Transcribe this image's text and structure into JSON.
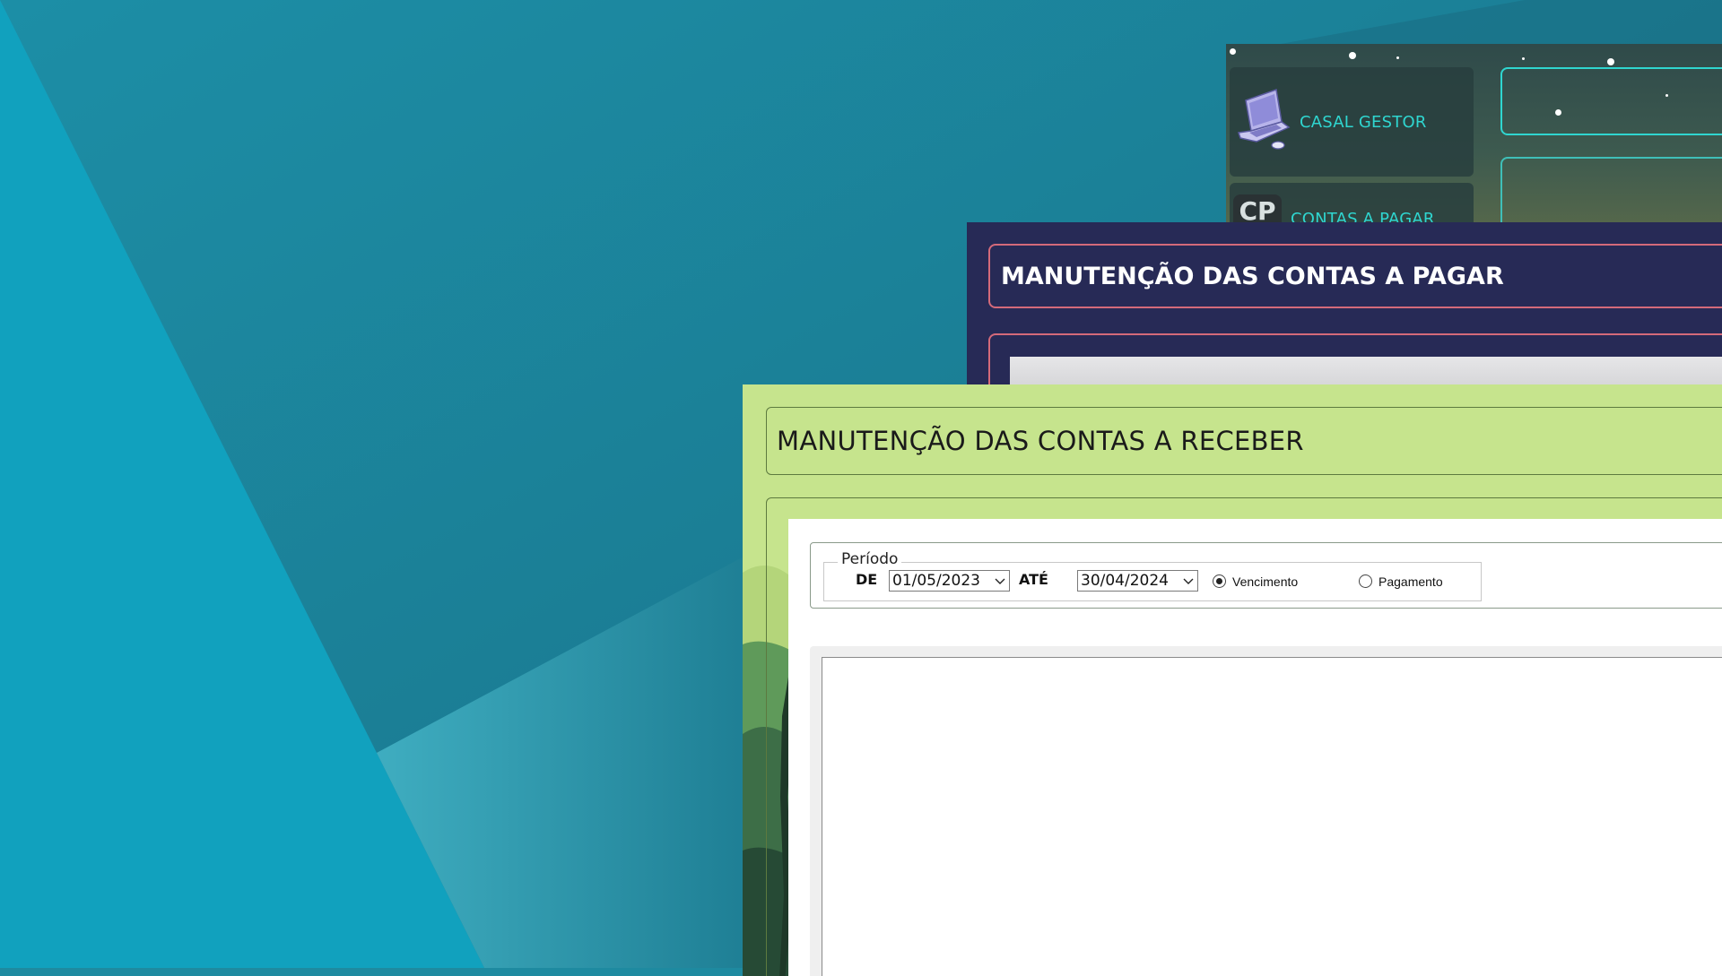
{
  "colors": {
    "desktop_base": "#1e8aa0",
    "desktop_light": "#12a0be",
    "gestor_accent": "#2fd6d0",
    "pagar_bg": "#272a56",
    "pagar_border": "#d46a7a",
    "receber_bg": "#c6e48d"
  },
  "gestor": {
    "app_name": "CASAL GESTOR",
    "logo_icon": "laptop-icon",
    "menu": [
      {
        "badge": "CP",
        "label": "CONTAS A PAGAR"
      }
    ]
  },
  "pagar": {
    "title": "MANUTENÇÃO DAS CONTAS A PAGAR"
  },
  "receber": {
    "title": "MANUTENÇÃO DAS CONTAS A RECEBER",
    "filter": {
      "legend": "Período",
      "from_label": "DE",
      "from_value": "01/05/2023",
      "to_label": "ATÉ",
      "to_value": "30/04/2024",
      "options": [
        {
          "label": "Vencimento",
          "checked": true
        },
        {
          "label": "Pagamento",
          "checked": false
        }
      ]
    }
  }
}
